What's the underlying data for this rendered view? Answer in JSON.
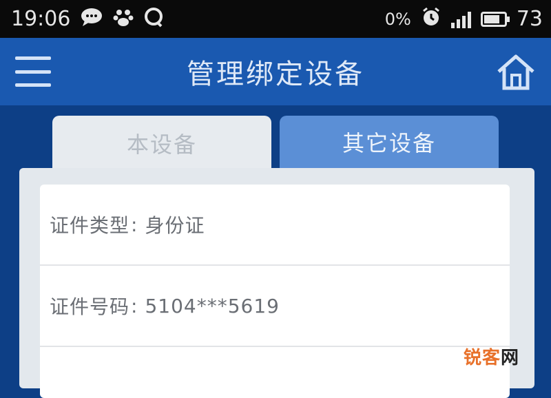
{
  "status_bar": {
    "time": "19:06",
    "network_speed": "0%",
    "battery_level": "73",
    "icons": [
      "message-icon",
      "paw-icon",
      "qq-icon",
      "alarm-icon",
      "signal-icon",
      "battery-icon"
    ]
  },
  "header": {
    "title": "管理绑定设备",
    "menu_icon": "hamburger-menu-icon",
    "home_icon": "home-icon"
  },
  "tabs": [
    {
      "label": "本设备",
      "selected": false
    },
    {
      "label": "其它设备",
      "selected": true
    }
  ],
  "details": {
    "id_type_label": "证件类型",
    "id_type_value": "身份证",
    "id_number_label": "证件号码",
    "id_number_value": "5104***5619"
  },
  "watermark": {
    "part1": "锐客",
    "part2": "网"
  },
  "colors": {
    "status_bar": "#0a0a0a",
    "header": "#1a59b0",
    "background": "#0d3f86",
    "active_tab": "#5b8fd6",
    "inactive_tab": "#e7ebef"
  }
}
